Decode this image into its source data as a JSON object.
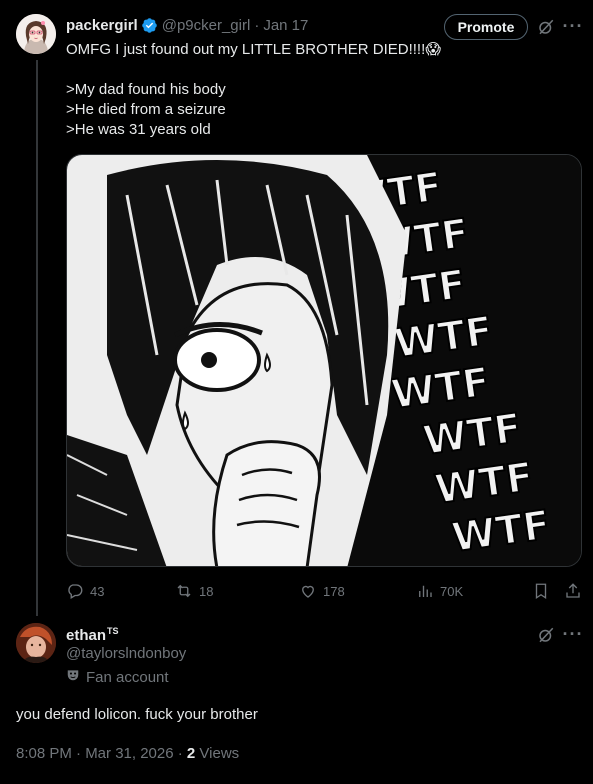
{
  "post": {
    "display_name": "packergirl",
    "handle": "@p9cker_girl",
    "separator": "·",
    "date": "Jan 17",
    "promote_label": "Promote",
    "text_line1": "OMFG I just found out my LITTLE BROTHER DIED!!!!😱",
    "text_line2": ">My dad found his body",
    "text_line3": ">He died from a seizure",
    "text_line4": ">He was 31 years old",
    "media_text": [
      "WTF",
      "WTF",
      "WTF",
      "WTF",
      "WTF",
      "WTF",
      "WTF",
      "WTF"
    ],
    "stats": {
      "replies": "43",
      "reposts": "18",
      "likes": "178",
      "views": "70K"
    }
  },
  "reply": {
    "display_name": "ethan",
    "name_badge": "TS",
    "handle": "@taylorslndonboy",
    "fan_label": "Fan account",
    "text": "you defend lolicon. fuck your brother",
    "timestamp": "8:08 PM · Mar 31, 2026 · ",
    "views_count": "2",
    "views_label": " Views"
  },
  "icons": {
    "verified": "verified-badge-icon",
    "grok": "grok-icon",
    "more": "more-icon",
    "reply": "reply-icon",
    "repost": "repost-icon",
    "like": "like-icon",
    "views": "views-icon",
    "bookmark": "bookmark-icon",
    "share": "share-icon",
    "fan": "fan-mask-icon"
  },
  "colors": {
    "background": "#000000",
    "text": "#e7e9ea",
    "muted": "#71767b",
    "verified": "#1d9bf0",
    "border": "#2f3336"
  }
}
